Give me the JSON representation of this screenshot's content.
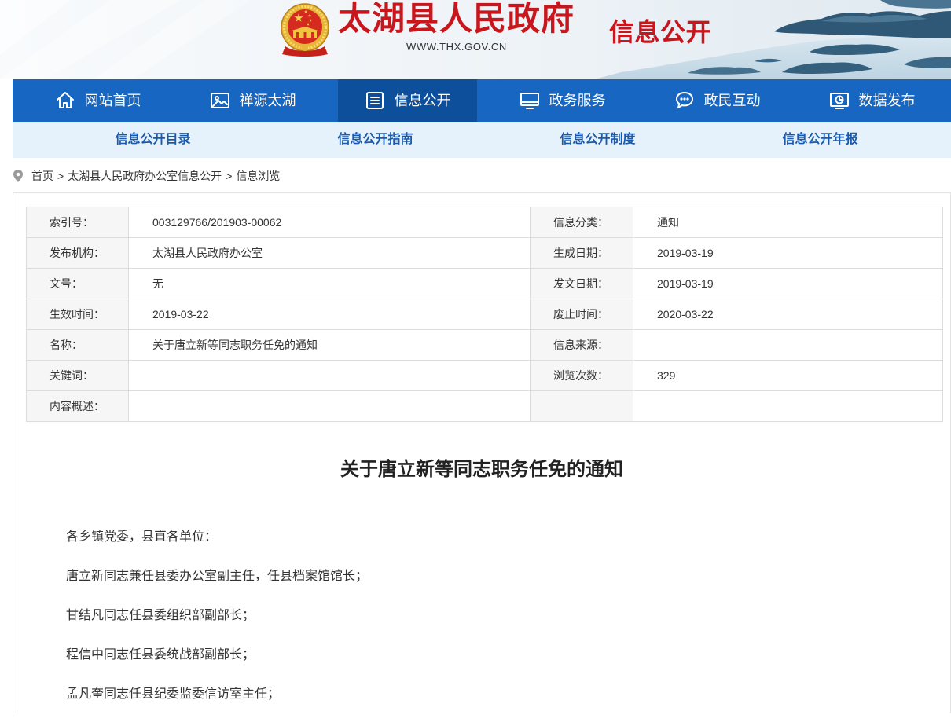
{
  "header": {
    "site_title": "太湖县人民政府",
    "site_url": "WWW.THX.GOV.CN",
    "section_title": "信息公开",
    "emblem_icon": "national-emblem-icon"
  },
  "nav": {
    "items": [
      {
        "label": "网站首页",
        "icon": "home-icon",
        "active": false
      },
      {
        "label": "禅源太湖",
        "icon": "image-icon",
        "active": false
      },
      {
        "label": "信息公开",
        "icon": "list-icon",
        "active": true
      },
      {
        "label": "政务服务",
        "icon": "monitor-icon",
        "active": false
      },
      {
        "label": "政民互动",
        "icon": "chat-icon",
        "active": false
      },
      {
        "label": "数据发布",
        "icon": "chart-screen-icon",
        "active": false
      }
    ]
  },
  "subnav": {
    "items": [
      "信息公开目录",
      "信息公开指南",
      "信息公开制度",
      "信息公开年报"
    ]
  },
  "breadcrumb": {
    "icon": "location-pin-icon",
    "separator": ">",
    "items": [
      "首页",
      "太湖县人民政府办公室信息公开",
      "信息浏览"
    ]
  },
  "info_table": {
    "rows": [
      [
        {
          "label": "索引号：",
          "value": "003129766/201903-00062"
        },
        {
          "label": "信息分类：",
          "value": "通知"
        }
      ],
      [
        {
          "label": "发布机构：",
          "value": "太湖县人民政府办公室"
        },
        {
          "label": "生成日期：",
          "value": "2019-03-19"
        }
      ],
      [
        {
          "label": "文号：",
          "value": "无"
        },
        {
          "label": "发文日期：",
          "value": "2019-03-19"
        }
      ],
      [
        {
          "label": "生效时间：",
          "value": "2019-03-22"
        },
        {
          "label": "废止时间：",
          "value": "2020-03-22"
        }
      ],
      [
        {
          "label": "名称：",
          "value": "关于唐立新等同志职务任免的通知"
        },
        {
          "label": "信息来源：",
          "value": ""
        }
      ],
      [
        {
          "label": "关键词：",
          "value": ""
        },
        {
          "label": "浏览次数：",
          "value": "329"
        }
      ],
      [
        {
          "label": "内容概述：",
          "value": ""
        },
        {
          "label": "",
          "value": ""
        }
      ]
    ]
  },
  "article": {
    "title": "关于唐立新等同志职务任免的通知",
    "paragraphs": [
      "各乡镇党委，县直各单位：",
      "唐立新同志兼任县委办公室副主任，任县档案馆馆长；",
      "甘结凡同志任县委组织部副部长；",
      "程信中同志任县委统战部副部长；",
      "孟凡奎同志任县纪委监委信访室主任；"
    ]
  },
  "colors": {
    "nav_bg": "#1766c2",
    "nav_active_bg": "#0e4f9b",
    "subnav_bg": "#e6f2fb",
    "subnav_text": "#1b5aab",
    "brand_red": "#c8161d",
    "label_cell_bg": "#f6f6f6"
  }
}
